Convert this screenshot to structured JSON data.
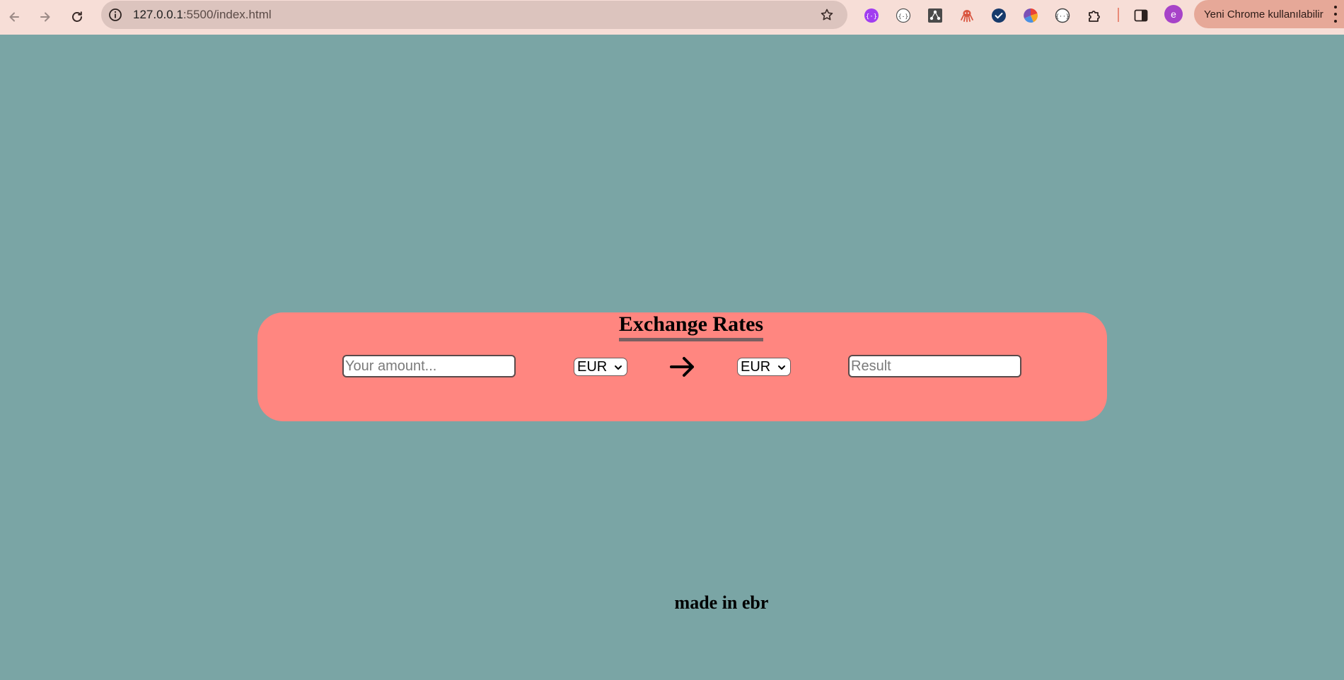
{
  "browser": {
    "url_host": "127.0.0.1",
    "url_path": ":5500/index.html",
    "update_label": "Yeni Chrome kullanılabilir",
    "profile_initial": "e",
    "extensions": [
      "jsonvue-icon",
      "json-formatter-icon",
      "graph-icon",
      "octopus-icon",
      "check-badge-icon",
      "color-wheel-icon",
      "braces-icon",
      "puzzle-icon"
    ]
  },
  "page": {
    "title": "Exchange Rates",
    "amount_placeholder": "Your amount...",
    "from_currency": "EUR",
    "to_currency": "EUR",
    "result_placeholder": "Result",
    "footer": "made in ebr"
  },
  "colors": {
    "page_bg": "#7aa5a5",
    "card_bg": "#ff8680",
    "chrome_bg": "#f7ded7"
  }
}
